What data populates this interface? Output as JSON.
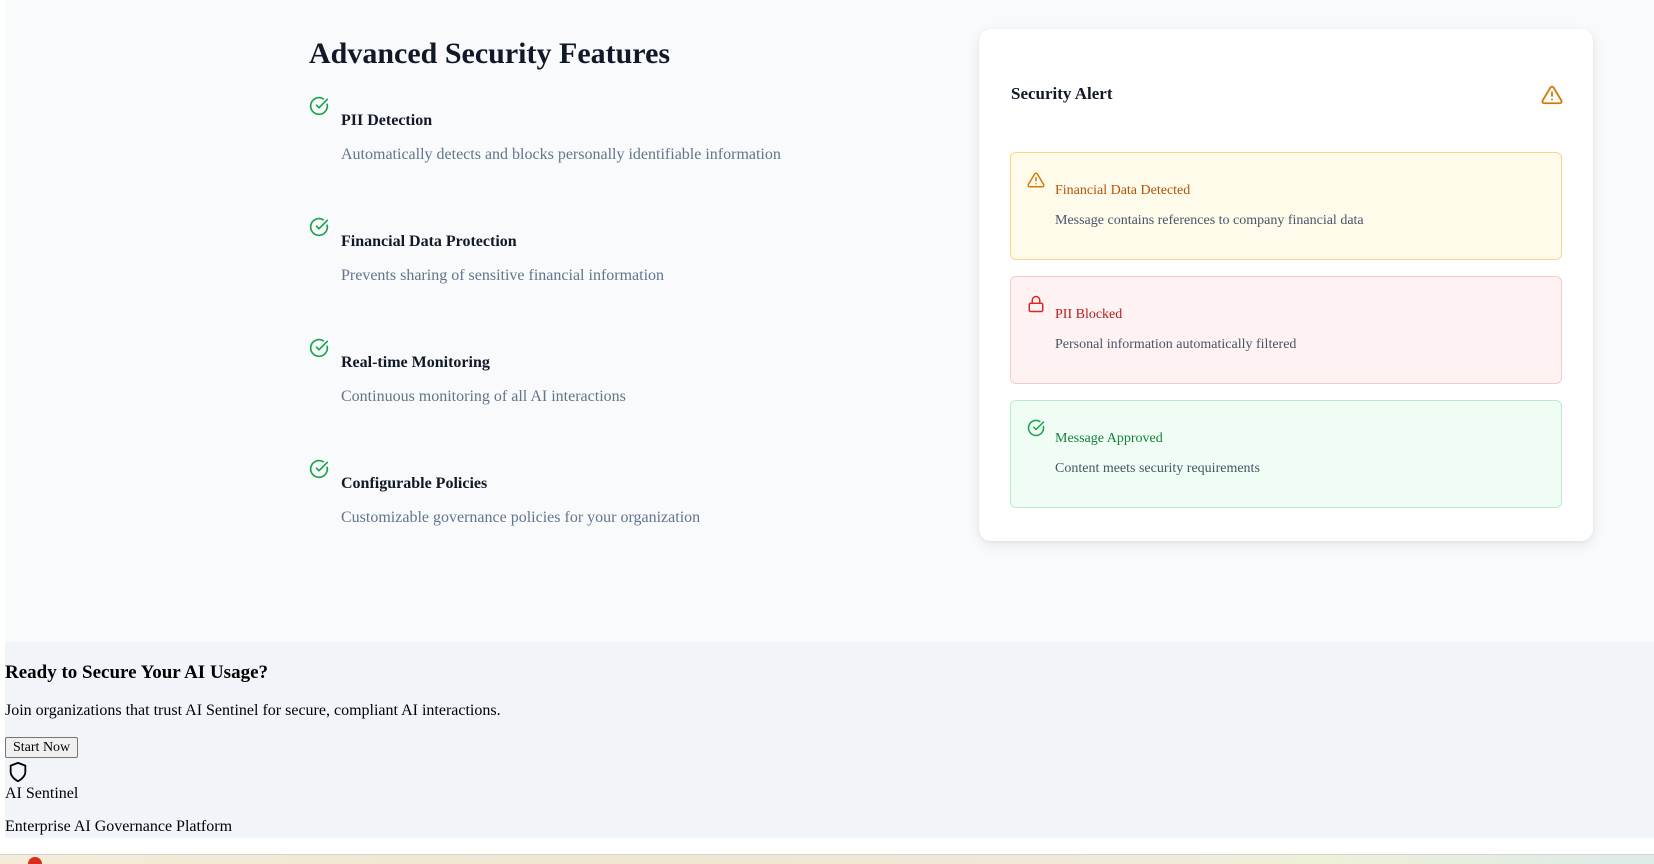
{
  "features": {
    "title": "Advanced Security Features",
    "items": [
      {
        "title": "PII Detection",
        "description": "Automatically detects and blocks personally identifiable information"
      },
      {
        "title": "Financial Data Protection",
        "description": "Prevents sharing of sensitive financial information"
      },
      {
        "title": "Real-time Monitoring",
        "description": "Continuous monitoring of all AI interactions"
      },
      {
        "title": "Configurable Policies",
        "description": "Customizable governance policies for your organization"
      }
    ]
  },
  "alert_card": {
    "title": "Security Alert",
    "alerts": [
      {
        "title": "Financial Data Detected",
        "description": "Message contains references to company financial data",
        "icon": "warning-icon"
      },
      {
        "title": "PII Blocked",
        "description": "Personal information automatically filtered",
        "icon": "lock-icon"
      },
      {
        "title": "Message Approved",
        "description": "Content meets security requirements",
        "icon": "check-circle-icon"
      }
    ]
  },
  "cta": {
    "title": "Ready to Secure Your AI Usage?",
    "description": "Join organizations that trust AI Sentinel for secure, compliant AI interactions.",
    "button_label": "Start Now"
  },
  "footer": {
    "brand_name": "AI Sentinel",
    "tagline": "Enterprise AI Governance Platform"
  },
  "colors": {
    "success": "#16a34a",
    "warning": "#d97706",
    "danger": "#dc2626"
  }
}
